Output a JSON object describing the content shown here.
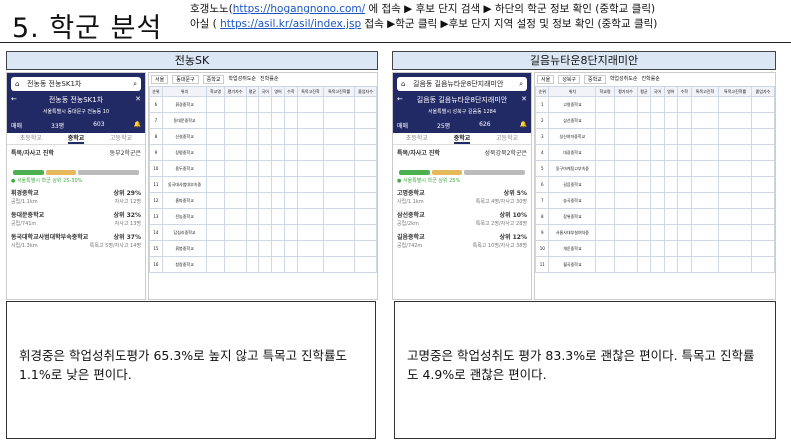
{
  "header": {
    "title": "5. 학군 분석",
    "line1": {
      "pre": "호갱노노(",
      "url": "https://hogangnono.com/",
      "post": " 에 접속 ▶ 후보 단지 검색 ▶ 하단의 학군 정보 확인 (중학교 클릭)"
    },
    "line2": {
      "pre": "아실 ( ",
      "url": "https://asil.kr/asil/index.jsp",
      "post": " 접속 ▶학군 클릭 ▶후보 단지 지역 설정 및 정보 확인 (중학교 클릭)"
    }
  },
  "left": {
    "panel_title": "전농SK",
    "search": "전농동 전농SK1차",
    "apt_name": "전농동 전농SK1차",
    "apt_addr": "서울특별시 동대문구 전농동 10",
    "stats": {
      "a": "매매",
      "b": "33평",
      "c": "603"
    },
    "tabs": [
      "초등학교",
      "중학교",
      "고등학교"
    ],
    "section": "특목/자사고 진학",
    "section_right": "동부2학군은",
    "legend": "서울특별시 학군 상위 25-30%",
    "rank_note": "● 서울특별시 학군 상위 25-30%",
    "schools": [
      {
        "name": "휘경중학교",
        "dist": "공립/1.1km",
        "rank": "상위 29%",
        "sub": "자사고 12명"
      },
      {
        "name": "동대문중학교",
        "dist": "공립/741m",
        "rank": "상위 32%",
        "sub": "자사고 13명"
      },
      {
        "name": "동국대학교사범대학부속중학교",
        "dist": "사립/1.3km",
        "rank": "상위 37%",
        "sub": "특목고 5명/자사고 14명"
      }
    ]
  },
  "right": {
    "panel_title": "길음뉴타운8단지래미안",
    "search": "길음동 길음뉴타운8단지래미안",
    "apt_name": "길음동 길음뉴타운8단지래미안",
    "apt_addr": "서울특별시 성북구 길음동 1284",
    "stats": {
      "a": "매매",
      "b": "25평",
      "c": "626"
    },
    "tabs": [
      "초등학교",
      "중학교",
      "고등학교"
    ],
    "section": "특목/자사고 진학",
    "section_right": "성북강북2학군은",
    "rank_note": "● 서울특별시 학군 상위 25%",
    "schools": [
      {
        "name": "고명중학교",
        "dist": "사립/1.1km",
        "rank": "상위 5%",
        "sub": "특목고 4명/자사고 30명"
      },
      {
        "name": "삼선중학교",
        "dist": "공립/2km",
        "rank": "상위 10%",
        "sub": "특목고 2명/자사고 28명"
      },
      {
        "name": "길음중학교",
        "dist": "공립/742m",
        "rank": "상위 12%",
        "sub": "특목고 10명/자사고 38명"
      }
    ]
  },
  "notes": {
    "left": "휘경중은 학업성취도평가 65.3%로 높지 않고 특목고 진학률도 1.1%로 낮은 편이다.",
    "right": "고명중은 학업성취도 평가 83.3%로 괜찮은 편이다. 특목고 진학률도 4.9%로 괜찮은 편이다."
  },
  "table_left": {
    "filters": [
      "서울",
      "동대문구",
      "중학교"
    ],
    "radio": [
      "학업성취도순",
      "진학률순"
    ],
    "headers": [
      "순위",
      "위치",
      "학교명",
      "평가자수",
      "평균",
      "국어",
      "영어",
      "수학",
      "특목고진학",
      "특목고진학률",
      "졸업자수"
    ],
    "rows": [
      [
        "6",
        "휘경중학교"
      ],
      [
        "7",
        "동대문중학교"
      ],
      [
        "8",
        "신설중학교"
      ],
      [
        "9",
        "장평중학교"
      ],
      [
        "10",
        "용두중학교"
      ],
      [
        "11",
        "동국대사범대부속중"
      ],
      [
        "12",
        "홍파중학교"
      ],
      [
        "13",
        "전농중학교"
      ],
      [
        "14",
        "답십리중학교"
      ],
      [
        "15",
        "휘봉중학교"
      ],
      [
        "16",
        "청량중학교"
      ]
    ]
  },
  "table_right": {
    "filters": [
      "서울",
      "성북구",
      "중학교"
    ],
    "radio": [
      "학업성취도순",
      "진학률순"
    ],
    "rows": [
      [
        "1",
        "고명중학교"
      ],
      [
        "2",
        "삼선중학교"
      ],
      [
        "3",
        "성신여자중학교"
      ],
      [
        "4",
        "대광중학교"
      ],
      [
        "5",
        "동구마케팅고부속중"
      ],
      [
        "6",
        "길음중학교"
      ],
      [
        "7",
        "숭곡중학교"
      ],
      [
        "8",
        "장위중학교"
      ],
      [
        "9",
        "서울사대부설여자중"
      ],
      [
        "10",
        "개운중학교"
      ],
      [
        "11",
        "월곡중학교"
      ]
    ]
  }
}
